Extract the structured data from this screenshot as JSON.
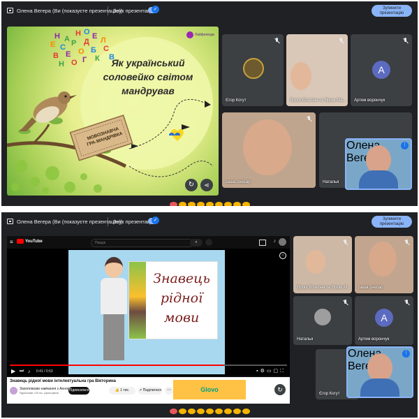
{
  "screen1": {
    "topbar": {
      "title": "Олена Вегера (Ви (показуєте презентацію))",
      "sound_label": "Звук презентації",
      "stop_button": "Зупинити презентацію"
    },
    "slide": {
      "letters": [
        "Н",
        "О",
        "Е",
        "С",
        "Р",
        "Д",
        "Л",
        "В",
        "Е",
        "О",
        "Б",
        "Н",
        "О",
        "Г",
        "Е",
        "К",
        "С",
        "В",
        "А",
        "Н"
      ],
      "title_lines": [
        "Як український",
        "соловейко світом",
        "мандрував"
      ],
      "ticket_text": [
        "МОВОЗНАВЧА",
        "ГРА-МАНДРІВКА"
      ],
      "logo_text": "Лайфенінди"
    },
    "participants": [
      {
        "name": "Єгор Когут"
      },
      {
        "name": "Ярош Віталіна та Ярош Ма…"
      },
      {
        "name": "Артем ворончук",
        "initial": "A"
      },
      {
        "name": "саша снесар"
      },
      {
        "name": "Наталья"
      },
      {
        "name": "Олена Вегера"
      }
    ],
    "colors": {
      "meet_bg": "#202124",
      "accent": "#8ab4f8",
      "avatar": "#5c6bc0"
    }
  },
  "screen2": {
    "topbar": {
      "title": "Олена Вегера (Ви (показуєте презентацію))",
      "sound_label": "Звук презентації",
      "stop_button": "Зупинити презентацію"
    },
    "youtube": {
      "logo": "YouTube",
      "search_placeholder": "Пошук",
      "slide_lines": [
        "Знавець",
        "рідної",
        "мови"
      ],
      "time": "0:41 / 0:53",
      "video_title": "Знавець рідної мови інтелектуальна гра Вікторина",
      "channel": "Захоплюємо навчання з Анною…",
      "subscribers": "Підписників: 125 тис. користувачів",
      "subscribe_label": "Підписатися",
      "likes": "1 тис.",
      "share_label": "Поділитися",
      "ad_label": "Glovo"
    },
    "participants": [
      {
        "name": "Ярош Віталіна та Ярош М…"
      },
      {
        "name": "саша снесар"
      },
      {
        "name": "Наталья"
      },
      {
        "name": "Артем ворончук",
        "initial": "A"
      },
      {
        "name": "Єгор Когут"
      },
      {
        "name": "Олена Вегера"
      }
    ]
  }
}
